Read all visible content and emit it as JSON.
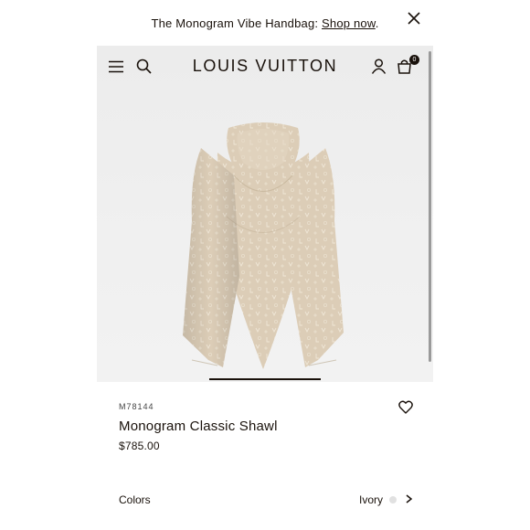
{
  "banner": {
    "text": "The Monogram Vibe Handbag: ",
    "link_label": "Shop now",
    "suffix": "."
  },
  "header": {
    "brand": "LOUIS VUITTON",
    "bag_count": "0",
    "icons": [
      "menu-icon",
      "search-icon",
      "account-icon",
      "bag-icon"
    ]
  },
  "product": {
    "sku": "M78144",
    "name": "Monogram Classic Shawl",
    "price": "$785.00"
  },
  "colors": {
    "label": "Colors",
    "selected": "Ivory"
  },
  "theme": {
    "text": "#19110b",
    "hero_bg": "#efefef",
    "scarf": "#dccdb7"
  }
}
